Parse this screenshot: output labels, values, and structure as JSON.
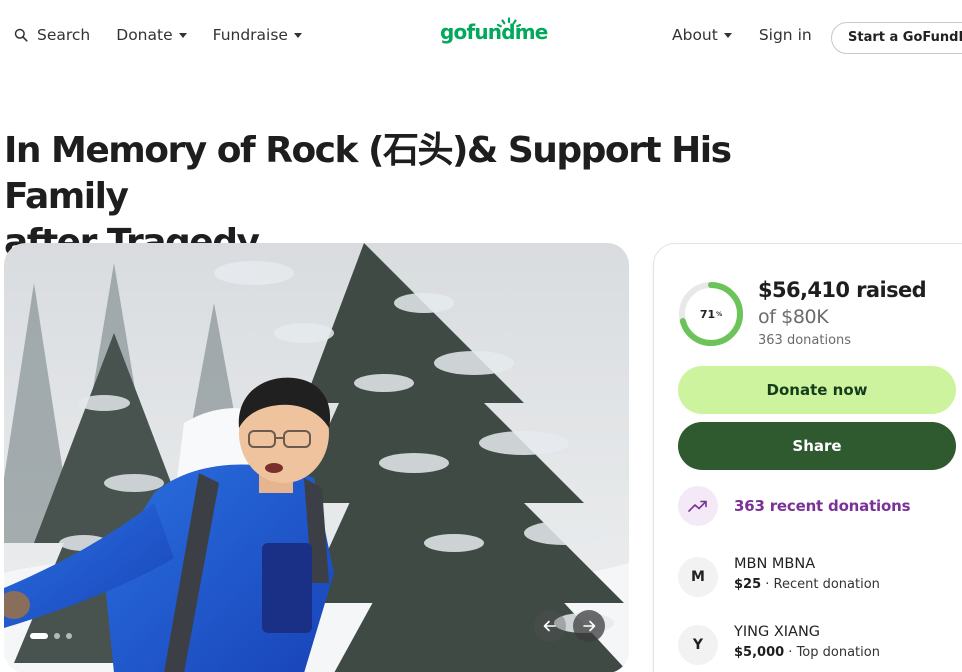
{
  "header": {
    "search_label": "Search",
    "donate_label": "Donate",
    "fundraise_label": "Fundraise",
    "logo_text": "gofundme",
    "about_label": "About",
    "signin_label": "Sign in",
    "start_label": "Start a GoFundMe"
  },
  "campaign": {
    "title_line1": "In Memory of Rock (石头)& Support His Family",
    "title_line2": "after Tragedy"
  },
  "carousel": {
    "prev_icon": "arrow-left-icon",
    "next_icon": "arrow-right-icon"
  },
  "progress": {
    "percent": 71,
    "percent_text": "71",
    "percent_symbol": "%",
    "raised": "$56,410 raised",
    "goal": "of $80K",
    "donations_count": "363 donations"
  },
  "actions": {
    "donate_label": "Donate now",
    "share_label": "Share"
  },
  "recent": {
    "label": "363 recent donations",
    "icon": "trending-up-icon"
  },
  "donations": [
    {
      "initial": "M",
      "name": "MBN MBNA",
      "amount": "$25",
      "type": " · Recent donation"
    },
    {
      "initial": "Y",
      "name": "YING XIANG",
      "amount": "$5,000",
      "type": " · Top donation"
    }
  ],
  "colors": {
    "brand_green": "#02a95c",
    "donate_bg": "#cdf39f",
    "share_bg": "#2f5a30",
    "recent_purple": "#7b3298"
  }
}
